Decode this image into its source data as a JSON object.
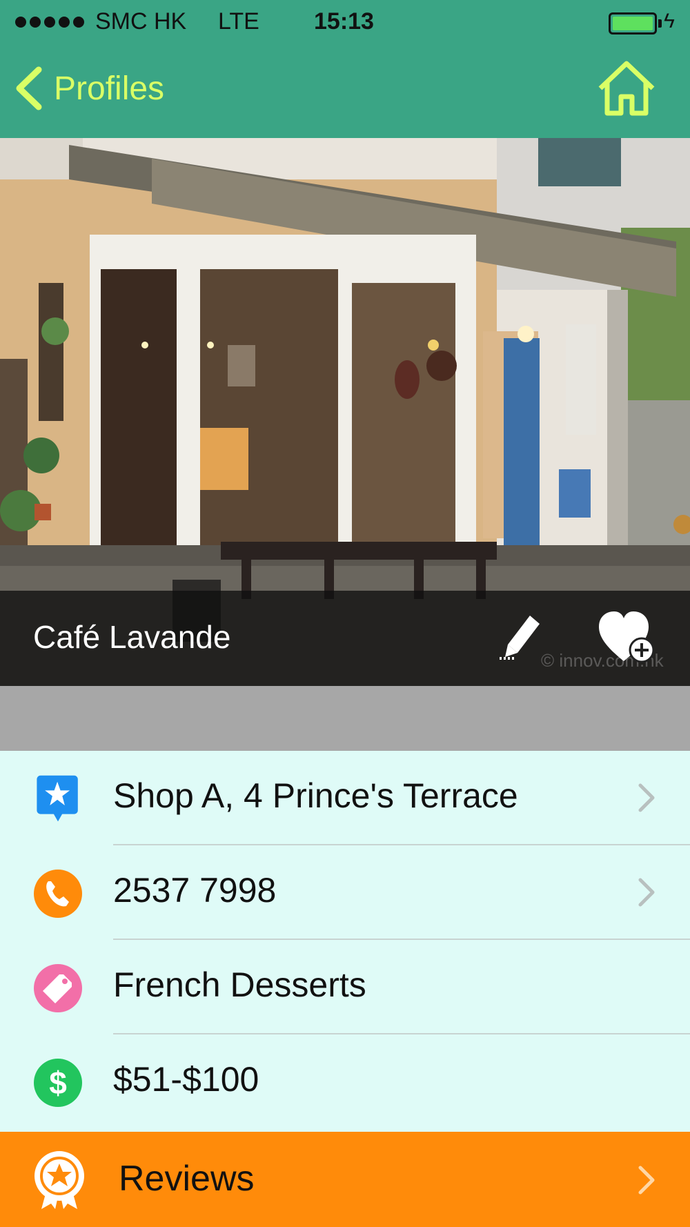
{
  "status_bar": {
    "carrier": "SMC HK",
    "network": "LTE",
    "time": "15:13"
  },
  "nav": {
    "back_label": "Profiles",
    "back_icon": "chevron-left-icon",
    "home_icon": "home-icon"
  },
  "hero": {
    "title": "Café Lavande",
    "edit_icon": "pencil-icon",
    "favorite_icon": "heart-plus-icon",
    "watermark": "© innov.com.hk"
  },
  "details": {
    "address": "Shop A, 4 Prince's Terrace",
    "phone": "2537 7998",
    "category": "French Desserts",
    "price_range": "$51-$100"
  },
  "reviews": {
    "label": "Reviews"
  },
  "colors": {
    "nav_bg": "#3aa585",
    "accent_text": "#d9ff66",
    "list_bg": "#dffbf7",
    "reviews_bg": "#ff8b0a",
    "address_icon": "#1e8ff0",
    "phone_icon": "#ff8b0a",
    "category_icon": "#f26fa8",
    "price_icon": "#22c55e"
  }
}
